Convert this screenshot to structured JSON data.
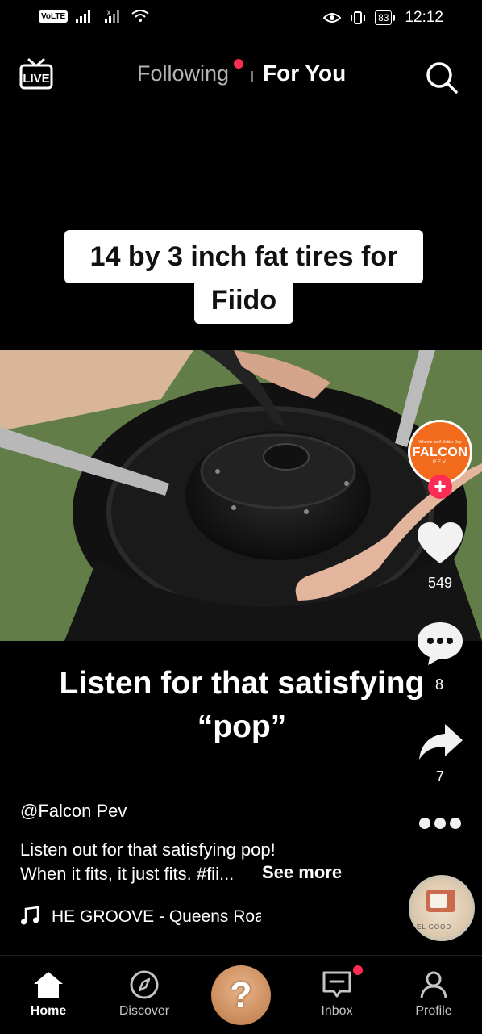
{
  "status_bar": {
    "volte": "VoLTE",
    "battery": "83",
    "time": "12:12"
  },
  "top_nav": {
    "live": "LIVE",
    "following": "Following",
    "for_you": "For You"
  },
  "video": {
    "caption_line1": "14 by 3 inch fat tires for",
    "caption_line2": "Fiido",
    "overlay_line1": "Listen for that satisfying",
    "overlay_line2": "“pop”"
  },
  "creator": {
    "avatar_tagline": "Wheels for A Better Day",
    "avatar_brand": "FALCON",
    "avatar_sub": "PEV",
    "follow": "+"
  },
  "actions": {
    "likes": "549",
    "comments": "8",
    "shares": "7"
  },
  "post": {
    "username": "@Falcon Pev",
    "description_line1": "Listen out for that satisfying pop!",
    "description_line2": "When it fits, it just fits. #fii...",
    "see_more": "See more",
    "song": "HE GROOVE - Queens Road",
    "disc_text": "EL GOOD"
  },
  "bottom_nav": {
    "home": "Home",
    "discover": "Discover",
    "create": "?",
    "inbox": "Inbox",
    "profile": "Profile"
  },
  "colors": {
    "accent": "#fe2c55",
    "brand_orange": "#f26a1b",
    "background": "#000000"
  }
}
